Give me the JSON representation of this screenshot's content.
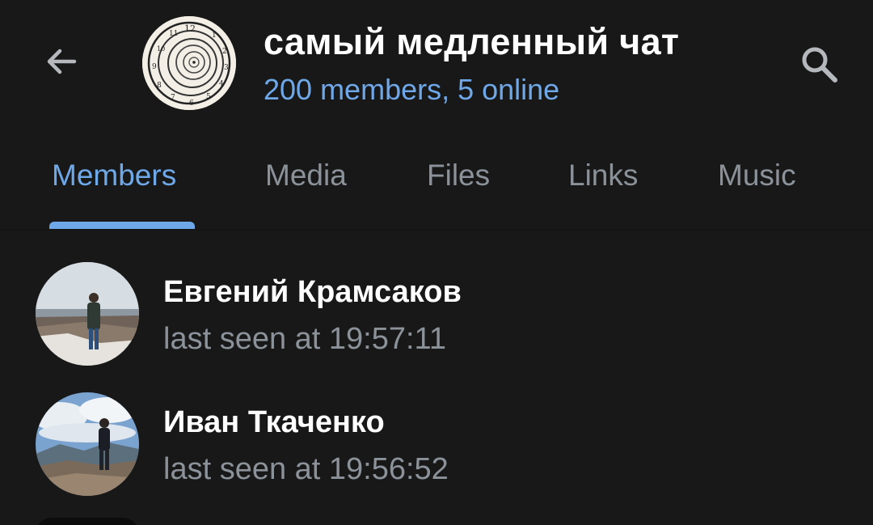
{
  "header": {
    "title": "самый медленный чат",
    "subtitle": "200 members, 5 online",
    "back_icon": "arrow-left-icon",
    "search_icon": "search-icon"
  },
  "tabs": [
    {
      "label": "Members",
      "active": true
    },
    {
      "label": "Media",
      "active": false
    },
    {
      "label": "Files",
      "active": false
    },
    {
      "label": "Links",
      "active": false
    },
    {
      "label": "Music",
      "active": false
    }
  ],
  "members": [
    {
      "name": "Евгений Крамсаков",
      "status": "last seen at 19:57:11"
    },
    {
      "name": "Иван Ткаченко",
      "status": "last seen at 19:56:52"
    }
  ],
  "colors": {
    "background": "#181818",
    "accent": "#6ea8e8",
    "secondary_text": "#8b9299",
    "primary_text": "#ffffff"
  }
}
